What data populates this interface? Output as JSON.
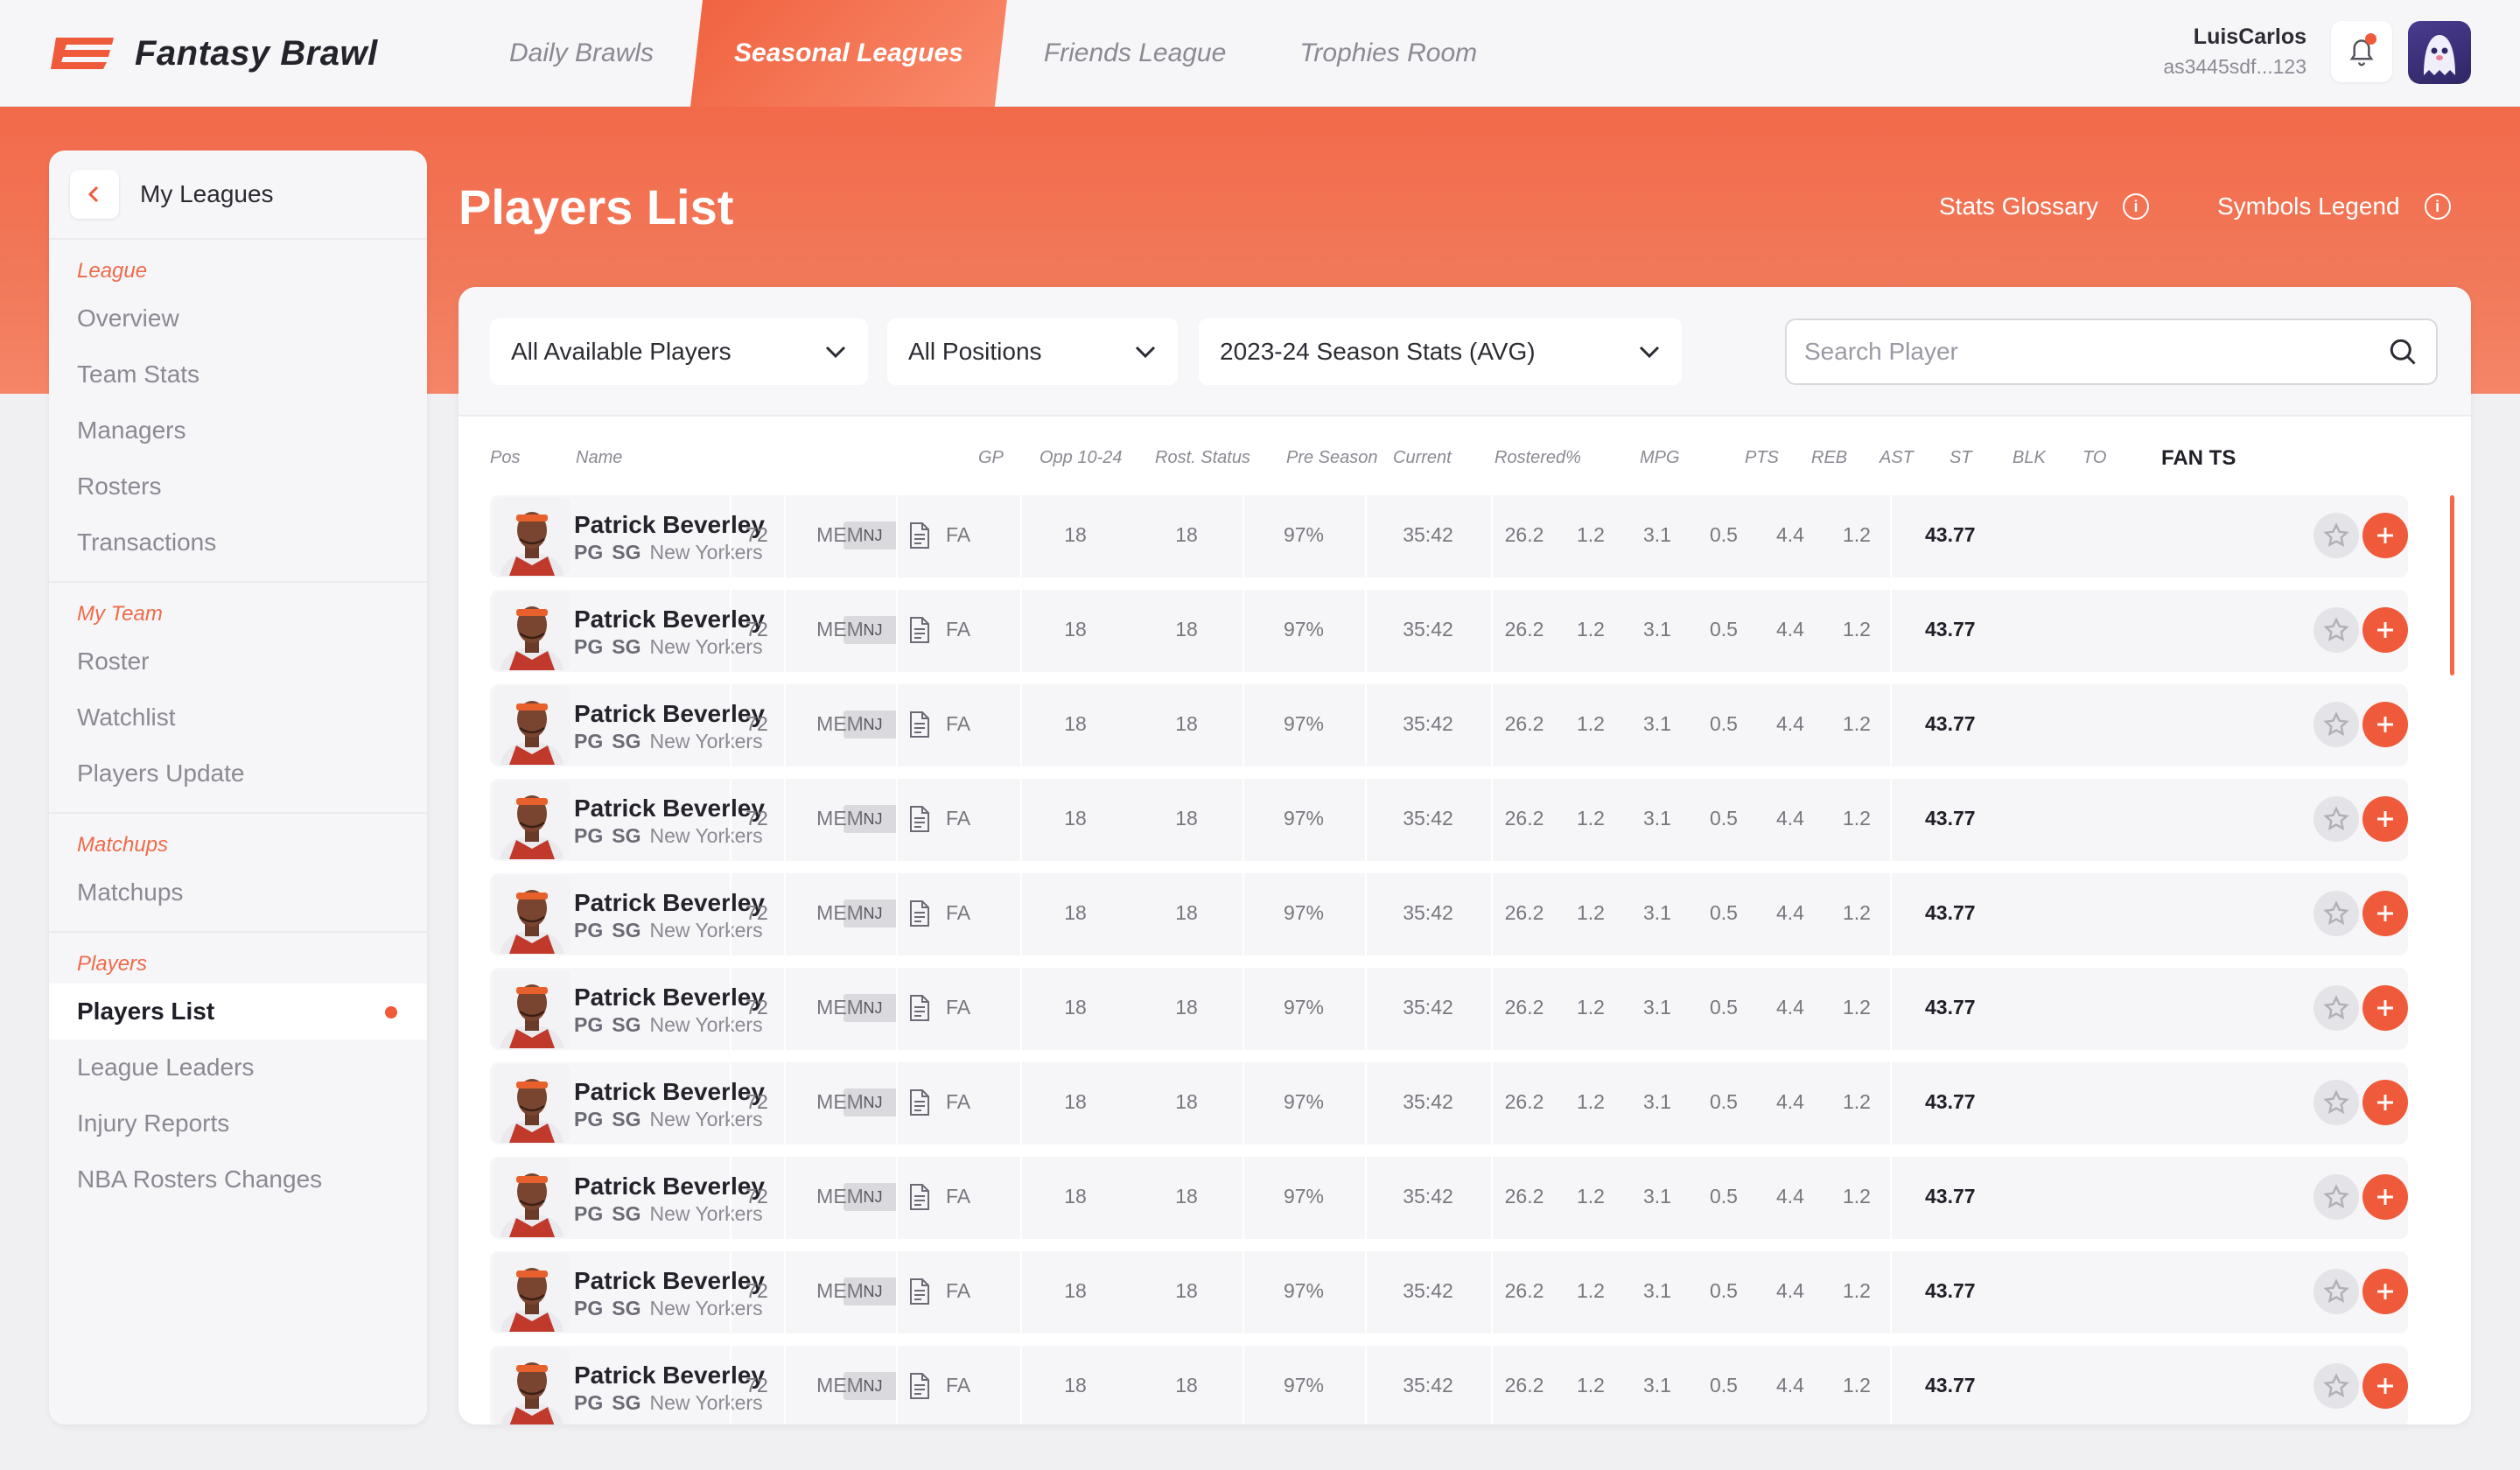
{
  "app": {
    "name": "Fantasy Brawl"
  },
  "nav": {
    "tabs": [
      {
        "label": "Daily Brawls",
        "active": false
      },
      {
        "label": "Seasonal Leagues",
        "active": true
      },
      {
        "label": "Friends League",
        "active": false
      },
      {
        "label": "Trophies Room",
        "active": false
      }
    ]
  },
  "user": {
    "name": "LuisCarlos",
    "id": "as3445sdf...123"
  },
  "colors": {
    "accent": "#ef5a3a",
    "band": "#f26a4a"
  },
  "sidebar": {
    "title": "My Leagues",
    "sections": [
      {
        "label": "League",
        "items": [
          "Overview",
          "Team Stats",
          "Managers",
          "Rosters",
          "Transactions"
        ]
      },
      {
        "label": "My Team",
        "items": [
          "Roster",
          "Watchlist",
          "Players Update"
        ]
      },
      {
        "label": "Matchups",
        "items": [
          "Matchups"
        ]
      },
      {
        "label": "Players",
        "items": [
          "Players List",
          "League Leaders",
          "Injury Reports",
          "NBA Rosters Changes"
        ]
      }
    ],
    "active_item": "Players List"
  },
  "page": {
    "title": "Players List",
    "stats_glossary": "Stats Glossary",
    "symbols_legend": "Symbols Legend"
  },
  "filters": {
    "availability": "All Available Players",
    "positions": "All Positions",
    "season": "2023-24 Season Stats (AVG)",
    "search_placeholder": "Search Player"
  },
  "table": {
    "headers": {
      "pos": "Pos",
      "name": "Name",
      "gp": "GP",
      "opp": "Opp 10-24",
      "rost": "Rost. Status",
      "pre": "Pre Season",
      "current": "Current",
      "rostered": "Rostered%",
      "mpg": "MPG",
      "pts": "PTS",
      "reb": "REB",
      "ast": "AST",
      "st": "ST",
      "blk": "BLK",
      "to": "TO",
      "fan": "FAN TS"
    },
    "rows": [
      {
        "name": "Patrick Beverley",
        "pos1": "PG",
        "pos2": "SG",
        "team": "New Yorkers",
        "status": "INJ",
        "gp": "72",
        "opp": "MEM",
        "rost": "FA",
        "pre": "18",
        "current": "18",
        "rostered": "97%",
        "mpg": "35:42",
        "pts": "26.2",
        "reb": "1.2",
        "ast": "3.1",
        "st": "0.5",
        "blk": "4.4",
        "to": "1.2",
        "fan": "43.77"
      },
      {
        "name": "Patrick Beverley",
        "pos1": "PG",
        "pos2": "SG",
        "team": "New Yorkers",
        "status": "INJ",
        "gp": "72",
        "opp": "MEM",
        "rost": "FA",
        "pre": "18",
        "current": "18",
        "rostered": "97%",
        "mpg": "35:42",
        "pts": "26.2",
        "reb": "1.2",
        "ast": "3.1",
        "st": "0.5",
        "blk": "4.4",
        "to": "1.2",
        "fan": "43.77"
      },
      {
        "name": "Patrick Beverley",
        "pos1": "PG",
        "pos2": "SG",
        "team": "New Yorkers",
        "status": "INJ",
        "gp": "72",
        "opp": "MEM",
        "rost": "FA",
        "pre": "18",
        "current": "18",
        "rostered": "97%",
        "mpg": "35:42",
        "pts": "26.2",
        "reb": "1.2",
        "ast": "3.1",
        "st": "0.5",
        "blk": "4.4",
        "to": "1.2",
        "fan": "43.77"
      },
      {
        "name": "Patrick Beverley",
        "pos1": "PG",
        "pos2": "SG",
        "team": "New Yorkers",
        "status": "INJ",
        "gp": "72",
        "opp": "MEM",
        "rost": "FA",
        "pre": "18",
        "current": "18",
        "rostered": "97%",
        "mpg": "35:42",
        "pts": "26.2",
        "reb": "1.2",
        "ast": "3.1",
        "st": "0.5",
        "blk": "4.4",
        "to": "1.2",
        "fan": "43.77"
      },
      {
        "name": "Patrick Beverley",
        "pos1": "PG",
        "pos2": "SG",
        "team": "New Yorkers",
        "status": "INJ",
        "gp": "72",
        "opp": "MEM",
        "rost": "FA",
        "pre": "18",
        "current": "18",
        "rostered": "97%",
        "mpg": "35:42",
        "pts": "26.2",
        "reb": "1.2",
        "ast": "3.1",
        "st": "0.5",
        "blk": "4.4",
        "to": "1.2",
        "fan": "43.77"
      },
      {
        "name": "Patrick Beverley",
        "pos1": "PG",
        "pos2": "SG",
        "team": "New Yorkers",
        "status": "INJ",
        "gp": "72",
        "opp": "MEM",
        "rost": "FA",
        "pre": "18",
        "current": "18",
        "rostered": "97%",
        "mpg": "35:42",
        "pts": "26.2",
        "reb": "1.2",
        "ast": "3.1",
        "st": "0.5",
        "blk": "4.4",
        "to": "1.2",
        "fan": "43.77"
      },
      {
        "name": "Patrick Beverley",
        "pos1": "PG",
        "pos2": "SG",
        "team": "New Yorkers",
        "status": "INJ",
        "gp": "72",
        "opp": "MEM",
        "rost": "FA",
        "pre": "18",
        "current": "18",
        "rostered": "97%",
        "mpg": "35:42",
        "pts": "26.2",
        "reb": "1.2",
        "ast": "3.1",
        "st": "0.5",
        "blk": "4.4",
        "to": "1.2",
        "fan": "43.77"
      },
      {
        "name": "Patrick Beverley",
        "pos1": "PG",
        "pos2": "SG",
        "team": "New Yorkers",
        "status": "INJ",
        "gp": "72",
        "opp": "MEM",
        "rost": "FA",
        "pre": "18",
        "current": "18",
        "rostered": "97%",
        "mpg": "35:42",
        "pts": "26.2",
        "reb": "1.2",
        "ast": "3.1",
        "st": "0.5",
        "blk": "4.4",
        "to": "1.2",
        "fan": "43.77"
      },
      {
        "name": "Patrick Beverley",
        "pos1": "PG",
        "pos2": "SG",
        "team": "New Yorkers",
        "status": "INJ",
        "gp": "72",
        "opp": "MEM",
        "rost": "FA",
        "pre": "18",
        "current": "18",
        "rostered": "97%",
        "mpg": "35:42",
        "pts": "26.2",
        "reb": "1.2",
        "ast": "3.1",
        "st": "0.5",
        "blk": "4.4",
        "to": "1.2",
        "fan": "43.77"
      },
      {
        "name": "Patrick Beverley",
        "pos1": "PG",
        "pos2": "SG",
        "team": "New Yorkers",
        "status": "INJ",
        "gp": "72",
        "opp": "MEM",
        "rost": "FA",
        "pre": "18",
        "current": "18",
        "rostered": "97%",
        "mpg": "35:42",
        "pts": "26.2",
        "reb": "1.2",
        "ast": "3.1",
        "st": "0.5",
        "blk": "4.4",
        "to": "1.2",
        "fan": "43.77"
      }
    ]
  }
}
